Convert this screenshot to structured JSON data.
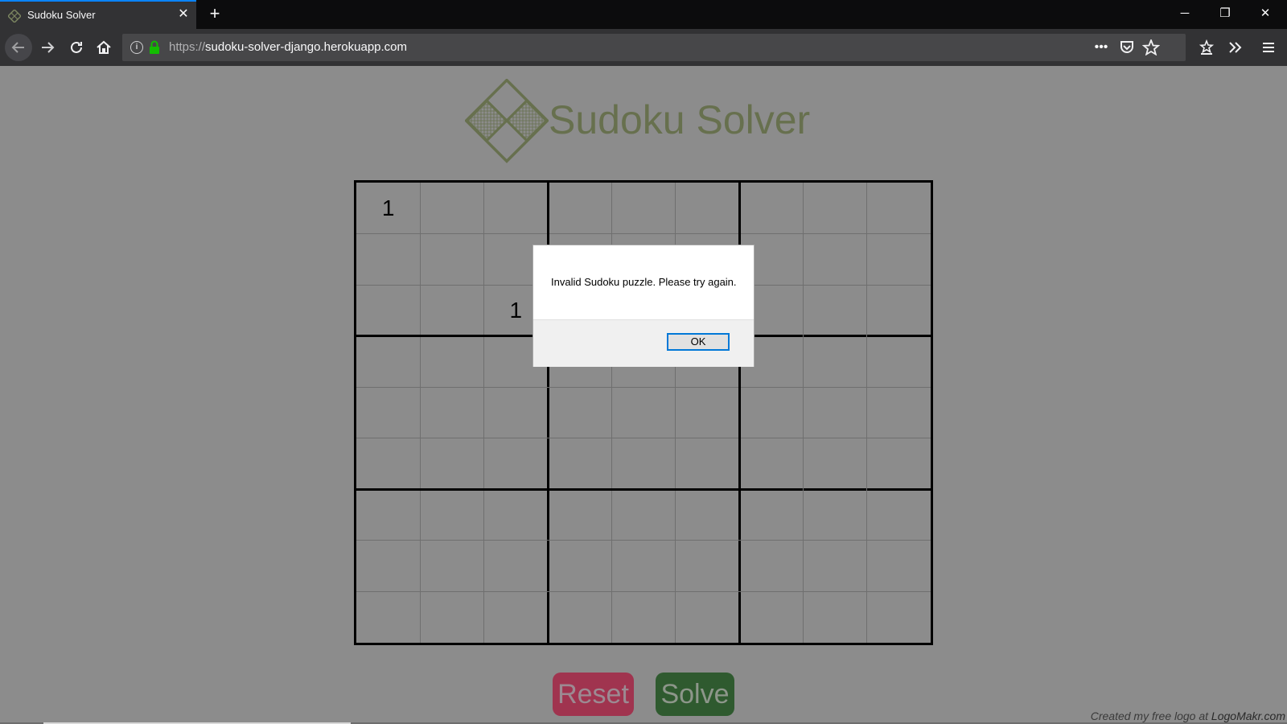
{
  "browser": {
    "tab_title": "Sudoku Solver",
    "tab_close": "✕",
    "new_tab": "+",
    "window_controls": {
      "minimize": "─",
      "restore": "❐",
      "close": "✕"
    },
    "url_protocol": "https://",
    "url_host": "sudoku-solver-django.herokuapp.com",
    "toolbar_icons": [
      "more-icon",
      "pocket-icon",
      "bookmark-star-icon",
      "library-icon",
      "overflow-icon",
      "menu-icon"
    ]
  },
  "page": {
    "logo_text": "Sudoku Solver",
    "logo_color": "#67704e",
    "grid": {
      "rows": 9,
      "cols": 9,
      "cells": [
        [
          "1",
          "",
          "",
          "",
          "",
          "",
          "",
          "",
          ""
        ],
        [
          "",
          "",
          "",
          "",
          "",
          "",
          "",
          "",
          ""
        ],
        [
          "",
          "",
          "1",
          "",
          "",
          "",
          "",
          "",
          ""
        ],
        [
          "",
          "",
          "",
          "",
          "",
          "",
          "",
          "",
          ""
        ],
        [
          "",
          "",
          "",
          "",
          "",
          "",
          "",
          "",
          ""
        ],
        [
          "",
          "",
          "",
          "",
          "",
          "",
          "",
          "",
          ""
        ],
        [
          "",
          "",
          "",
          "",
          "",
          "",
          "",
          "",
          ""
        ],
        [
          "",
          "",
          "",
          "",
          "",
          "",
          "",
          "",
          ""
        ],
        [
          "",
          "",
          "",
          "",
          "",
          "",
          "",
          "",
          ""
        ]
      ]
    },
    "buttons": {
      "reset": "Reset",
      "solve": "Solve"
    },
    "credit": {
      "prefix": "Created my free logo at ",
      "brand": "LogoMakr.com"
    }
  },
  "dialog": {
    "message": "Invalid Sudoku puzzle. Please try again.",
    "ok_label": "OK"
  }
}
